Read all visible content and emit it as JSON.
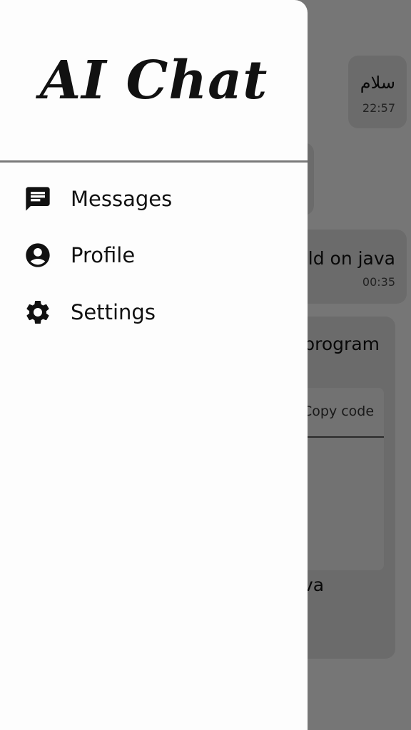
{
  "app": {
    "title": "AI Chat"
  },
  "drawer": {
    "items": [
      {
        "label": "Messages",
        "icon": "chat-icon"
      },
      {
        "label": "Profile",
        "icon": "account-circle-icon"
      },
      {
        "label": "Settings",
        "icon": "gear-icon"
      }
    ]
  },
  "chat": {
    "messages": [
      {
        "text": "سلام",
        "time": "22:57"
      },
      {
        "text": "ld on java",
        "time": "00:35"
      },
      {
        "text": "program"
      }
    ],
    "code_block": {
      "copy_label": "Copy code"
    },
    "trailing_fragment": "va"
  },
  "colors": {
    "scrim": "#00000080",
    "drawer_bg": "#fdfdfd",
    "divider": "#7a7a7a"
  }
}
